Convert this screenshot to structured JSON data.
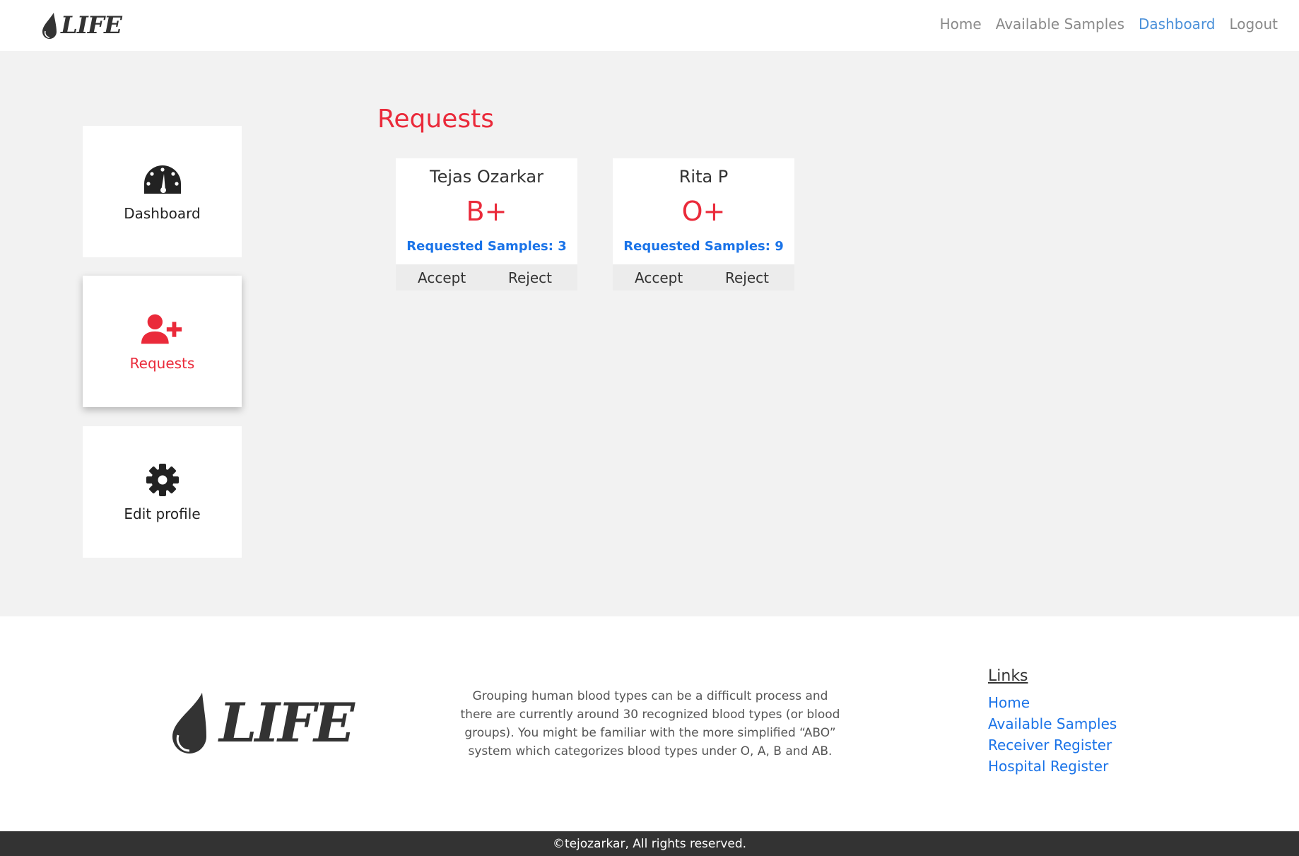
{
  "brand": {
    "name": "LIFE",
    "icon": "blood-drop-icon"
  },
  "nav": {
    "items": [
      {
        "label": "Home",
        "active": false
      },
      {
        "label": "Available Samples",
        "active": false
      },
      {
        "label": "Dashboard",
        "active": true
      },
      {
        "label": "Logout",
        "active": false
      }
    ]
  },
  "sidebar": {
    "items": [
      {
        "label": "Dashboard",
        "icon": "speedometer-icon",
        "active": false
      },
      {
        "label": "Requests",
        "icon": "user-plus-icon",
        "active": true
      },
      {
        "label": "Edit profile",
        "icon": "gear-icon",
        "active": false
      }
    ]
  },
  "main": {
    "title": "Requests",
    "requests": [
      {
        "name": "Tejas Ozarkar",
        "blood_type": "B+",
        "samples": "Requested Samples: 3",
        "accept": "Accept",
        "reject": "Reject"
      },
      {
        "name": "Rita P",
        "blood_type": "O+",
        "samples": "Requested Samples: 9",
        "accept": "Accept",
        "reject": "Reject"
      }
    ]
  },
  "footer": {
    "about": "Grouping human blood types can be a difficult process and there are currently around 30 recognized blood types (or blood groups). You might be familiar with the more simplified “ABO” system which categorizes blood types under O, A, B and AB.",
    "links_heading": "Links",
    "links": [
      "Home",
      "Available Samples",
      "Receiver Register",
      "Hospital Register"
    ],
    "copyright": "©tejozarkar, All rights reserved."
  },
  "colors": {
    "accent": "#ea2a3a",
    "link": "#1a73e8",
    "nav_active": "#4a90d9",
    "dark": "#333333"
  }
}
